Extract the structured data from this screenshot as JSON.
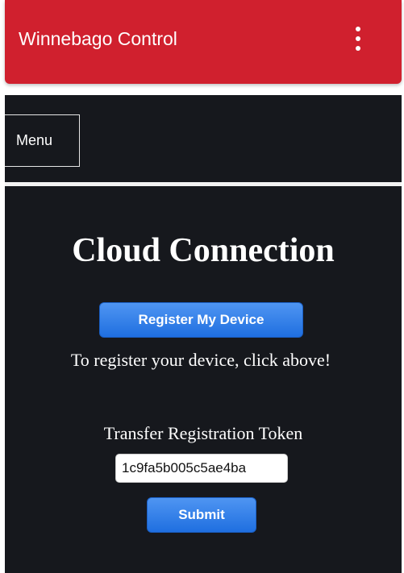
{
  "app_bar": {
    "title": "Winnebago Control",
    "overflow_icon": "more-vert-icon",
    "background": "#d0202e"
  },
  "nav": {
    "menu_label": "Menu"
  },
  "main": {
    "title": "Cloud Connection",
    "register_button_label": "Register My Device",
    "register_hint": "To register your device, click above!",
    "token_label": "Transfer Registration Token",
    "token_value": "1c9fa5b005c5ae4ba",
    "submit_label": "Submit",
    "background": "#16181d",
    "accent": "#2a7be6"
  }
}
